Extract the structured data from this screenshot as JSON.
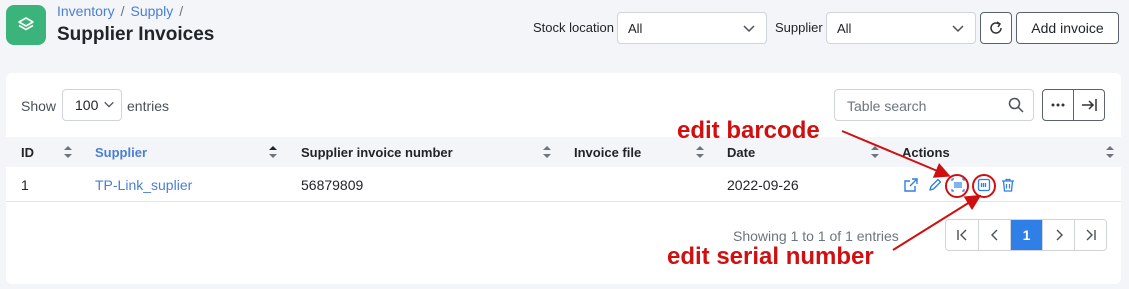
{
  "breadcrumb": [
    "Inventory",
    "Supply"
  ],
  "page_title": "Supplier Invoices",
  "filters": {
    "stock_location_label": "Stock location",
    "stock_location_value": "All",
    "supplier_label": "Supplier",
    "supplier_value": "All"
  },
  "add_invoice_label": "Add invoice",
  "table_controls": {
    "show_label": "Show",
    "page_size": "100",
    "entries_label": "entries",
    "search_placeholder": "Table search"
  },
  "columns": [
    "ID",
    "Supplier",
    "Supplier invoice number",
    "Invoice file",
    "Date",
    "Actions"
  ],
  "rows": [
    {
      "id": "1",
      "supplier": "TP-Link_suplier",
      "invoice_number": "56879809",
      "invoice_file": "",
      "date": "2022-09-26"
    }
  ],
  "row_actions": [
    "external-link-icon",
    "pencil-icon",
    "barcode-icon",
    "serial-number-icon",
    "trash-icon"
  ],
  "pagination": {
    "summary": "Showing 1 to 1 of 1 entries",
    "current_page": "1"
  },
  "annotations": {
    "edit_barcode": "edit barcode",
    "edit_serial": "edit serial number"
  },
  "colors": {
    "brand": "#3ab47a",
    "link": "#4a7fd4",
    "page_active": "#2f7fe6",
    "annotation": "#d01010"
  }
}
